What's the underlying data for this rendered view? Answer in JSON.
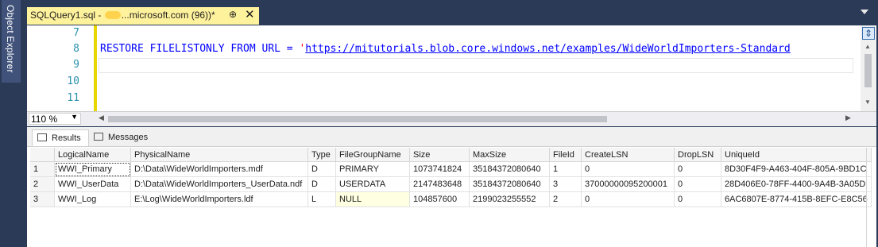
{
  "side_panel": {
    "label": "Object Explorer"
  },
  "tab": {
    "title_prefix": "SQLQuery1.sql - ",
    "title_suffix": "...microsoft.com (96))*",
    "pin": "⊕",
    "close": "✕"
  },
  "editor": {
    "line_numbers": [
      "7",
      "8",
      "9",
      "10",
      "11"
    ],
    "code": {
      "keywords": "RESTORE FILELISTONLY FROM URL = ",
      "quote": "'",
      "url": "https://mitutorials.blob.core.windows.net/examples/WideWorldImporters-Standard"
    }
  },
  "zoom": {
    "value": "110 %"
  },
  "results_tabs": {
    "results": "Results",
    "messages": "Messages"
  },
  "grid": {
    "columns": [
      "",
      "LogicalName",
      "PhysicalName",
      "Type",
      "FileGroupName",
      "Size",
      "MaxSize",
      "FileId",
      "CreateLSN",
      "DropLSN",
      "UniqueId"
    ],
    "rows": [
      [
        "1",
        "WWI_Primary",
        "D:\\Data\\WideWorldImporters.mdf",
        "D",
        "PRIMARY",
        "1073741824",
        "35184372080640",
        "1",
        "0",
        "0",
        "8D30F4F9-A463-404F-805A-9BD1C"
      ],
      [
        "2",
        "WWI_UserData",
        "D:\\Data\\WideWorldImporters_UserData.ndf",
        "D",
        "USERDATA",
        "2147483648",
        "35184372080640",
        "3",
        "37000000095200001",
        "0",
        "28D406E0-78FF-4400-9A4B-3A05D"
      ],
      [
        "3",
        "WWI_Log",
        "E:\\Log\\WideWorldImporters.ldf",
        "L",
        "NULL",
        "104857600",
        "2199023255552",
        "2",
        "0",
        "0",
        "6AC6807E-8774-415B-8EFC-E8C56"
      ]
    ]
  }
}
